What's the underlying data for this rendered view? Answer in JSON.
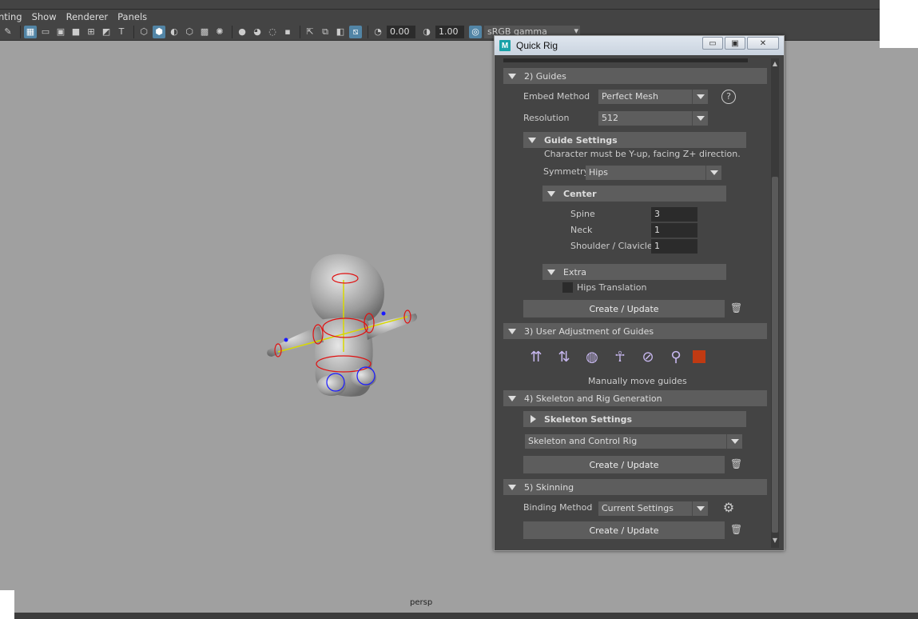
{
  "menubar": {
    "items": [
      "nting",
      "Show",
      "Renderer",
      "Panels"
    ]
  },
  "toolbar": {
    "exposure_value": "0.00",
    "gamma_value": "1.00",
    "color_space": "sRGB gamma"
  },
  "viewport": {
    "camera_label": "persp"
  },
  "quick_rig": {
    "title": "Quick Rig",
    "window_buttons": {
      "minimize": "▭",
      "maximize": "▣",
      "close": "✕"
    },
    "guides": {
      "header": "2) Guides",
      "embed_method_label": "Embed Method",
      "embed_method_value": "Perfect Mesh",
      "resolution_label": "Resolution",
      "resolution_value": "512",
      "guide_settings_header": "Guide Settings",
      "guide_note": "Character must be Y-up, facing Z+ direction.",
      "symmetry_label": "Symmetry",
      "symmetry_value": "Hips",
      "center_header": "Center",
      "spine_label": "Spine",
      "spine_value": "3",
      "neck_label": "Neck",
      "neck_value": "1",
      "shoulder_label": "Shoulder / Clavicle",
      "shoulder_value": "1",
      "extra_header": "Extra",
      "hips_translation_label": "Hips Translation",
      "create_update_label": "Create / Update"
    },
    "user_adjustment": {
      "header": "3) User Adjustment of Guides",
      "caption": "Manually move guides",
      "swatch_color": "#c03a12"
    },
    "skeleton": {
      "header": "4) Skeleton and Rig Generation",
      "settings_header": "Skeleton Settings",
      "type_value": "Skeleton and Control Rig",
      "create_update_label": "Create / Update"
    },
    "skinning": {
      "header": "5) Skinning",
      "binding_method_label": "Binding Method",
      "binding_method_value": "Current Settings",
      "create_update_label": "Create / Update"
    }
  }
}
